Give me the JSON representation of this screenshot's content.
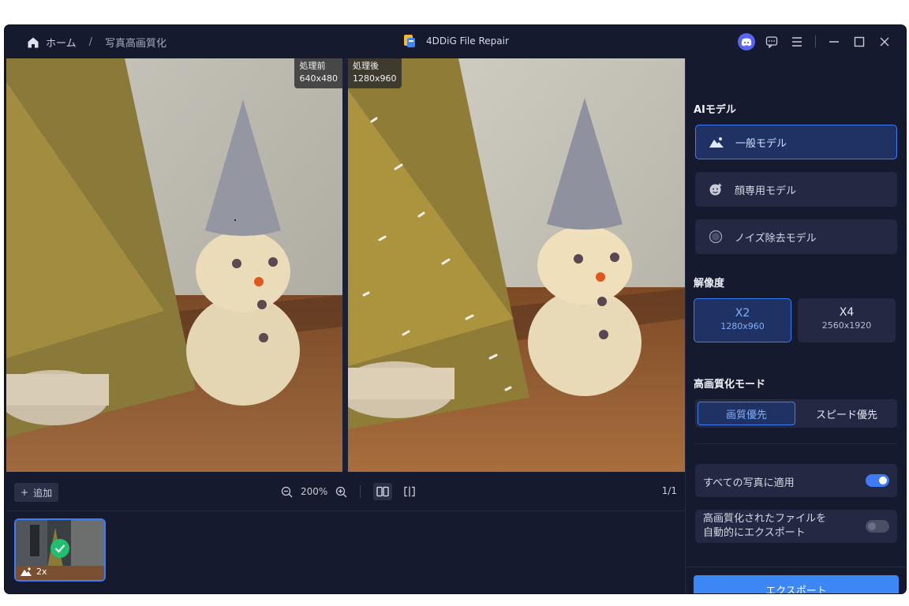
{
  "breadcrumb": {
    "home": "ホーム",
    "separator": "/",
    "current": "写真高画質化"
  },
  "app": {
    "title": "4DDiG File Repair"
  },
  "compare": {
    "before_label": "処理前",
    "before_size": "640x480",
    "after_label": "処理後",
    "after_size": "1280x960"
  },
  "toolbar": {
    "add_label": "追加",
    "zoom_level": "200%",
    "page_count": "1/1"
  },
  "thumbnail": {
    "scale": "2x"
  },
  "panel": {
    "ai_model_title": "AIモデル",
    "models": [
      {
        "label": "一般モデル",
        "icon": "landscape-icon",
        "selected": true
      },
      {
        "label": "顔専用モデル",
        "icon": "face-icon",
        "selected": false
      },
      {
        "label": "ノイズ除去モデル",
        "icon": "denoise-icon",
        "selected": false
      }
    ],
    "resolution_title": "解像度",
    "resolutions": [
      {
        "label": "X2",
        "size": "1280x960",
        "selected": true
      },
      {
        "label": "X4",
        "size": "2560x1920",
        "selected": false
      }
    ],
    "mode_title": "高画質化モード",
    "modes": [
      {
        "label": "画質優先",
        "selected": true
      },
      {
        "label": "スピード優先",
        "selected": false
      }
    ],
    "apply_all": {
      "label": "すべての写真に適用",
      "on": true
    },
    "auto_export": {
      "line1": "高画質化されたファイルを",
      "line2": "自動的にエクスポート",
      "on": false
    },
    "export_label": "エクスポート"
  },
  "colors": {
    "accent": "#3d86f5",
    "background": "#151a2e",
    "card": "#232943",
    "success": "#1fbf6e"
  }
}
